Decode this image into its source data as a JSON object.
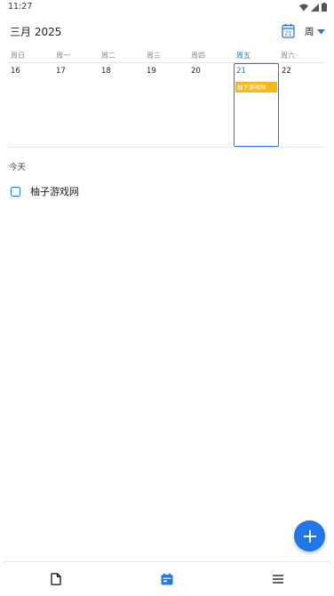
{
  "status_bar": {
    "time": "11:27"
  },
  "header": {
    "month_title": "三月 2025",
    "view_label": "周",
    "calendar_icon_day": "21"
  },
  "week": {
    "weekdays": [
      "周日",
      "周一",
      "周二",
      "周三",
      "周四",
      "周五",
      "周六"
    ],
    "days": [
      "16",
      "17",
      "18",
      "19",
      "20",
      "21",
      "22"
    ],
    "today_index": 5,
    "events": [
      {
        "day_index": 5,
        "title": "柚子游戏网",
        "color": "#f7b81b"
      }
    ]
  },
  "today_section": {
    "title": "今天",
    "tasks": [
      {
        "label": "柚子游戏网",
        "checked": false
      }
    ]
  },
  "colors": {
    "accent": "#1f77e8",
    "event": "#f7b81b"
  },
  "icons": {
    "fab": "plus-icon",
    "nav": [
      "document-icon",
      "calendar-icon",
      "menu-icon"
    ]
  }
}
